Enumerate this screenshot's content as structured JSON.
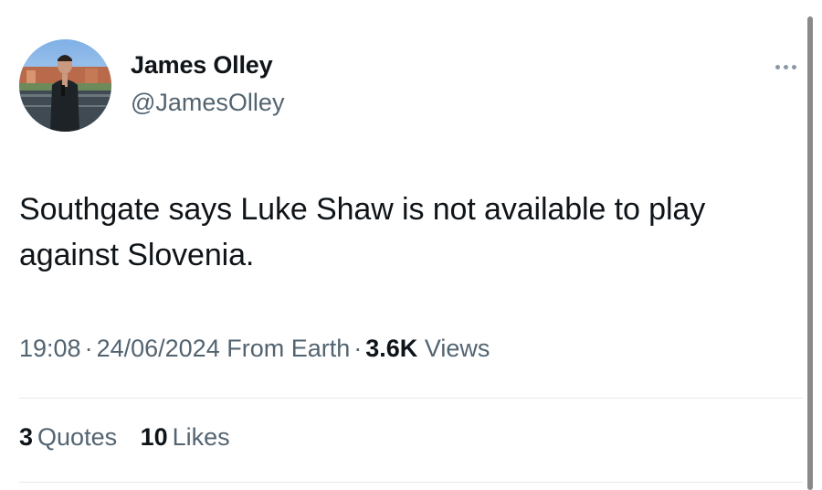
{
  "author": {
    "name": "James Olley",
    "handle": "@JamesOlley"
  },
  "tweet": {
    "text": "Southgate says Luke Shaw is not available to play against Slovenia."
  },
  "meta": {
    "time": "19:08",
    "separator": "·",
    "date": "24/06/2024",
    "source": "From Earth",
    "views_count": "3.6K",
    "views_label": "Views"
  },
  "stats": {
    "quotes_count": "3",
    "quotes_label": "Quotes",
    "likes_count": "10",
    "likes_label": "Likes"
  },
  "icons": {
    "more": "more-horizontal-icon"
  },
  "colors": {
    "text_primary": "#0f1419",
    "text_secondary": "#536471",
    "divider": "#e6e9ec"
  }
}
